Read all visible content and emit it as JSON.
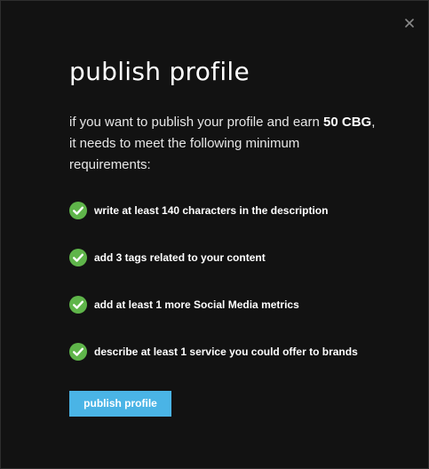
{
  "modal": {
    "title": "publish profile",
    "close_icon": "close-icon",
    "intro": {
      "before": "if you want to publish your profile and earn ",
      "highlight": "50 CBG",
      "after": ", it needs to meet the following minimum requirements:"
    },
    "requirements": [
      {
        "label": "write at least 140 characters in the description",
        "icon": "check-circle-icon",
        "met": true
      },
      {
        "label": "add 3 tags related to your content",
        "icon": "check-circle-icon",
        "met": true
      },
      {
        "label": "add at least 1 more Social Media metrics",
        "icon": "check-circle-icon",
        "met": true
      },
      {
        "label": "describe at least 1 service you could offer to brands",
        "icon": "check-circle-icon",
        "met": true
      }
    ],
    "publish_button_label": "publish profile"
  },
  "colors": {
    "background": "#121212",
    "check_green": "#5fb54a",
    "button_blue": "#4ab4e6",
    "text": "#ffffff",
    "close_icon": "#8a8a8a"
  }
}
